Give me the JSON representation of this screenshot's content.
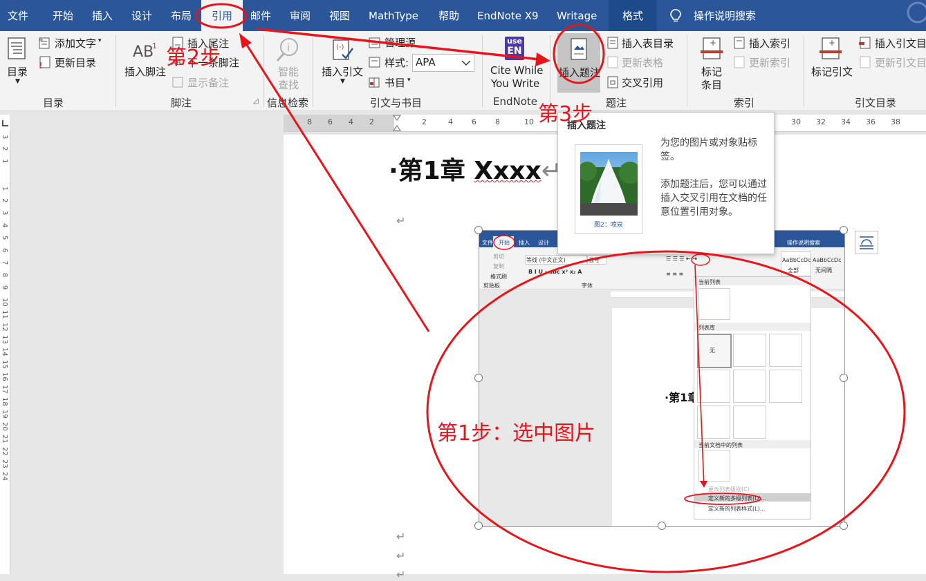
{
  "tabs": [
    "文件",
    "开始",
    "插入",
    "设计",
    "布局",
    "引用",
    "邮件",
    "审阅",
    "视图",
    "MathType",
    "帮助",
    "EndNote X9",
    "Writage",
    "格式"
  ],
  "active_tab": "引用",
  "tell_me": "操作说明搜索",
  "ribbon": {
    "toc": {
      "label": "目录",
      "add_text": "添加文字",
      "update": "更新目录",
      "group": "目录"
    },
    "footnotes": {
      "insert_footnote": "插入脚注",
      "insert_endnote": "插入尾注",
      "next_footnote": "下一条脚注",
      "show_notes": "显示备注",
      "group": "脚注"
    },
    "research": {
      "smart_lookup_1": "智能",
      "smart_lookup_2": "查找",
      "group": "信息检索"
    },
    "citations": {
      "insert_citation": "插入引文",
      "manage_sources": "管理源",
      "style_label": "样式:",
      "style_value": "APA",
      "bibliography": "书目",
      "group": "引文与书目"
    },
    "endnote": {
      "badge_top": "use",
      "badge_bottom": "EN",
      "cwyw_1": "Cite While",
      "cwyw_2": "You Write",
      "group": "EndNote"
    },
    "captions": {
      "insert_caption": "插入题注",
      "insert_table_of_figures": "插入表目录",
      "update_table": "更新表格",
      "cross_reference": "交叉引用",
      "group": "题注"
    },
    "index": {
      "mark_entry_1": "标记",
      "mark_entry_2": "条目",
      "insert_index": "插入索引",
      "update_index": "更新索引",
      "group": "索引"
    },
    "toa": {
      "mark_citation": "标记引文",
      "insert_toa": "插入引文目",
      "update_toa": "更新引文目",
      "group": "引文目录"
    }
  },
  "ruler": {
    "numbers": [
      "8",
      "6",
      "4",
      "2",
      "2",
      "4",
      "6",
      "8",
      "10",
      "30",
      "32",
      "34",
      "36",
      "38"
    ],
    "vertical": [
      "3",
      "2",
      "1",
      "1",
      "2",
      "3",
      "4",
      "5",
      "6",
      "7",
      "8",
      "9",
      "10",
      "11",
      "12",
      "13",
      "14",
      "15",
      "16",
      "17",
      "18",
      "19",
      "20",
      "21",
      "22",
      "23",
      "24"
    ]
  },
  "document": {
    "heading_prefix": "·第1章 ",
    "heading_word": "Xxxx",
    "para_mark": "↵"
  },
  "tooltip": {
    "title": "插入题注",
    "text1": "为您的图片或对象贴标签。",
    "text2": "添加题注后，您可以通过插入交叉引用在文档的任意位置引用对象。",
    "caption": "图2：喷泉"
  },
  "annotations": {
    "step1": "第1步：选中图片",
    "step2": "第2步",
    "step3": "第3步"
  },
  "embedded": {
    "tabs": [
      "文件",
      "开始",
      "插入",
      "设计"
    ],
    "tell_me": "操作说明搜索",
    "font": "等线 (中文正文)",
    "font_size": "五号",
    "cut": "剪切",
    "copy": "复制",
    "format_painter": "格式刷",
    "clipboard_group": "剪贴板",
    "font_group": "字体",
    "style1": "AaBbCcDc",
    "style1_label": "全部",
    "style2": "AaBbCcDc",
    "style2_label": "无间隔",
    "current_list": "当前列表",
    "list_library": "列表库",
    "none": "无",
    "doc_lists": "当前文档中的列表",
    "change_level": "更改列表级别(C)",
    "define_multilevel": "定义新的多级列表(D)...",
    "define_style": "定义新的列表样式(L)...",
    "heading": "·第1章"
  },
  "colors": {
    "ribbon_blue": "#2b579a",
    "annotation_red": "#e8141a"
  }
}
